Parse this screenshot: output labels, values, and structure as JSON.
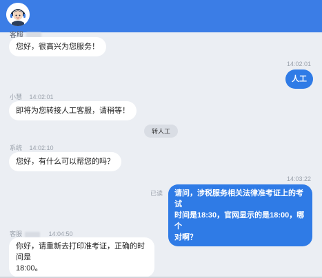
{
  "header": {
    "agent_name_partial": "客服"
  },
  "messages": [
    {
      "id": "m1",
      "side": "left",
      "text": "您好，很高兴为您服务！"
    },
    {
      "id": "m2",
      "side": "right",
      "time": "14:02:01",
      "text": "人工"
    },
    {
      "id": "m3",
      "side": "left",
      "sender": "小慧",
      "time": "14:02:01",
      "text": "即将为您转接人工客服，请稍等！"
    },
    {
      "id": "m4",
      "side": "center",
      "text": "转人工"
    },
    {
      "id": "m5",
      "side": "left",
      "sender": "系统",
      "time": "14:02:10",
      "text": "您好，有什么可以帮您的吗？"
    },
    {
      "id": "m6",
      "side": "right",
      "time": "14:03:22",
      "read_status": "已读",
      "text_lines": [
        "请问，涉税服务相关法律准考证上的考试",
        "时间是18:30，官网显示的是18:00，哪个",
        "对啊？"
      ]
    },
    {
      "id": "m7",
      "side": "left",
      "sender": "客服",
      "time": "14:04:50",
      "text_lines": [
        "你好，请重新去打印准考证，正确的时间是",
        "18:00。"
      ]
    }
  ]
}
